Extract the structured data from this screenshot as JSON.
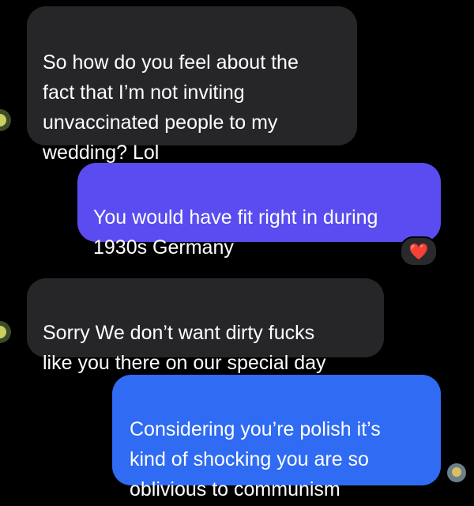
{
  "conversation": {
    "messages": [
      {
        "side": "incoming",
        "text": "So how do you feel about the\nfact that I’m not inviting\nunvaccinated people to my\nwedding? Lol"
      },
      {
        "side": "outgoing",
        "text": "You would have fit right in during\n1930s Germany",
        "reaction": "❤️"
      },
      {
        "side": "incoming",
        "text": "Sorry We don’t want dirty fucks\nlike you there on our special day"
      },
      {
        "side": "outgoing",
        "text": "Considering you’re polish it’s\nkind of shocking you are so\noblivious to communism"
      }
    ]
  },
  "colors": {
    "background": "#000000",
    "incoming_bubble": "#262628",
    "outgoing_bubble_top": "#5a4cf0",
    "outgoing_bubble_bottom": "#2f6bf3"
  },
  "icons": {
    "reaction": "heart-icon",
    "avatar": "avatar"
  }
}
